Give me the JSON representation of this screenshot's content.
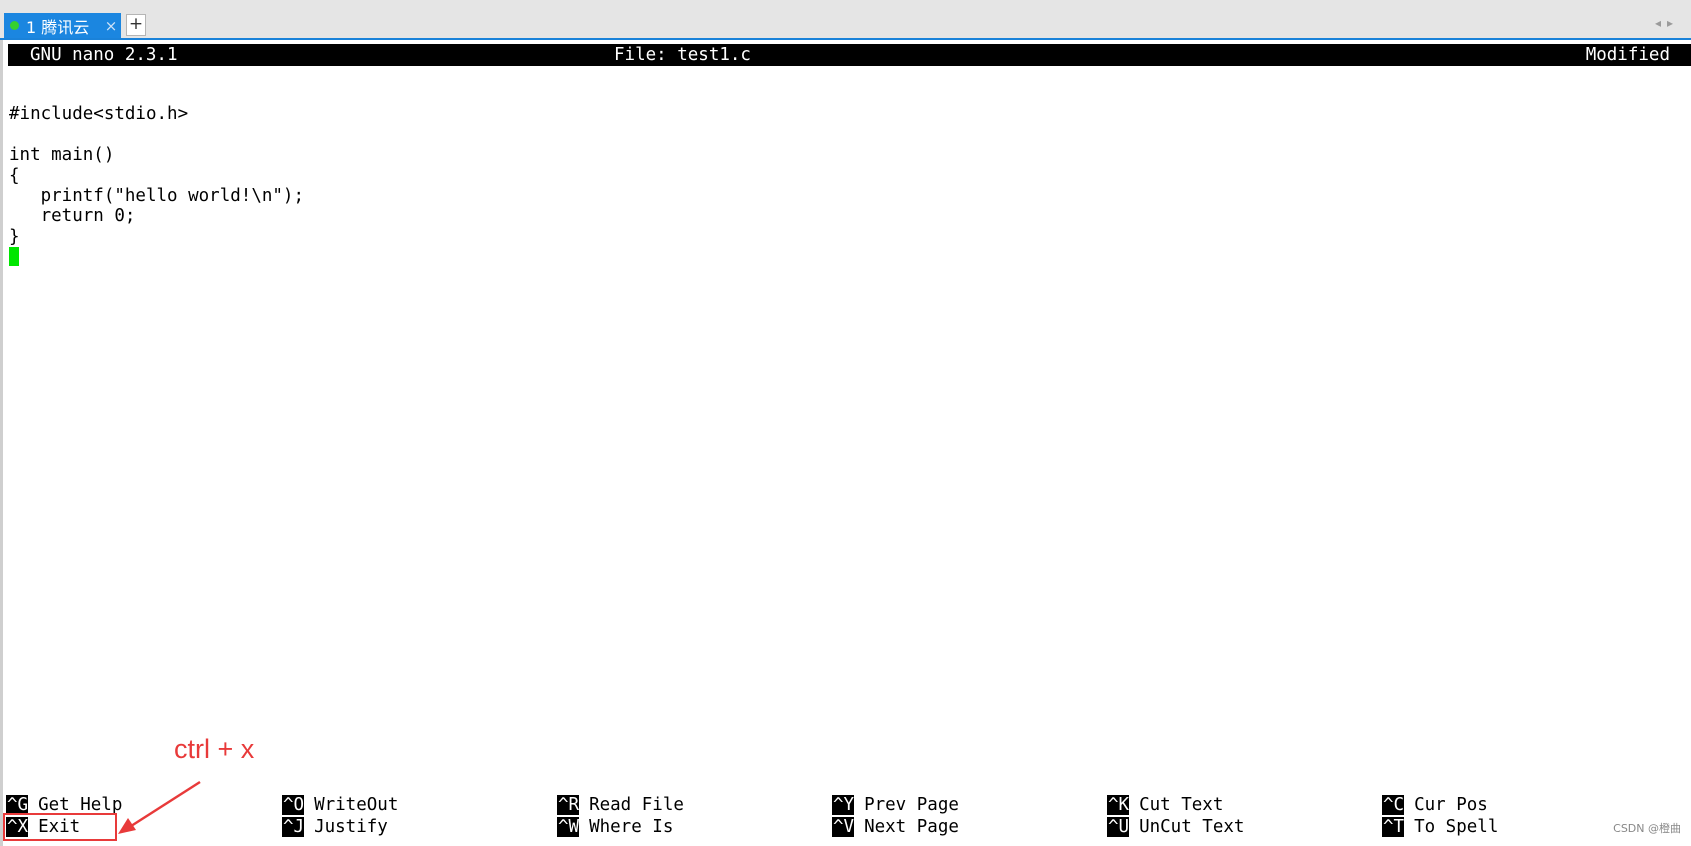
{
  "tabbar": {
    "tab_label": "1 腾讯云",
    "close_symbol": "×",
    "new_tab_symbol": "+",
    "nav_prev": "◂",
    "nav_next": "▸",
    "accent_color": "#1b86e0",
    "status_dot_color": "#35d12e"
  },
  "nano": {
    "version": "GNU nano 2.3.1",
    "file": "File: test1.c",
    "status": "Modified"
  },
  "editor": {
    "lines": [
      "",
      "#include<stdio.h>",
      "",
      "int main()",
      "{",
      "   printf(\"hello world!\\n\");",
      "   return 0;",
      "}"
    ],
    "cursor_color": "#00e600"
  },
  "shortcuts": {
    "row1": [
      {
        "key": "^G",
        "label": "Get Help"
      },
      {
        "key": "^O",
        "label": "WriteOut"
      },
      {
        "key": "^R",
        "label": "Read File"
      },
      {
        "key": "^Y",
        "label": "Prev Page"
      },
      {
        "key": "^K",
        "label": "Cut Text"
      },
      {
        "key": "^C",
        "label": "Cur Pos"
      }
    ],
    "row2": [
      {
        "key": "^X",
        "label": "Exit"
      },
      {
        "key": "^J",
        "label": "Justify"
      },
      {
        "key": "^W",
        "label": "Where Is"
      },
      {
        "key": "^V",
        "label": "Next Page"
      },
      {
        "key": "^U",
        "label": "UnCut Text"
      },
      {
        "key": "^T",
        "label": "To Spell"
      }
    ]
  },
  "annotation": {
    "text": "ctrl + x",
    "color": "#e83a3a"
  },
  "watermark": "CSDN @橙曲"
}
